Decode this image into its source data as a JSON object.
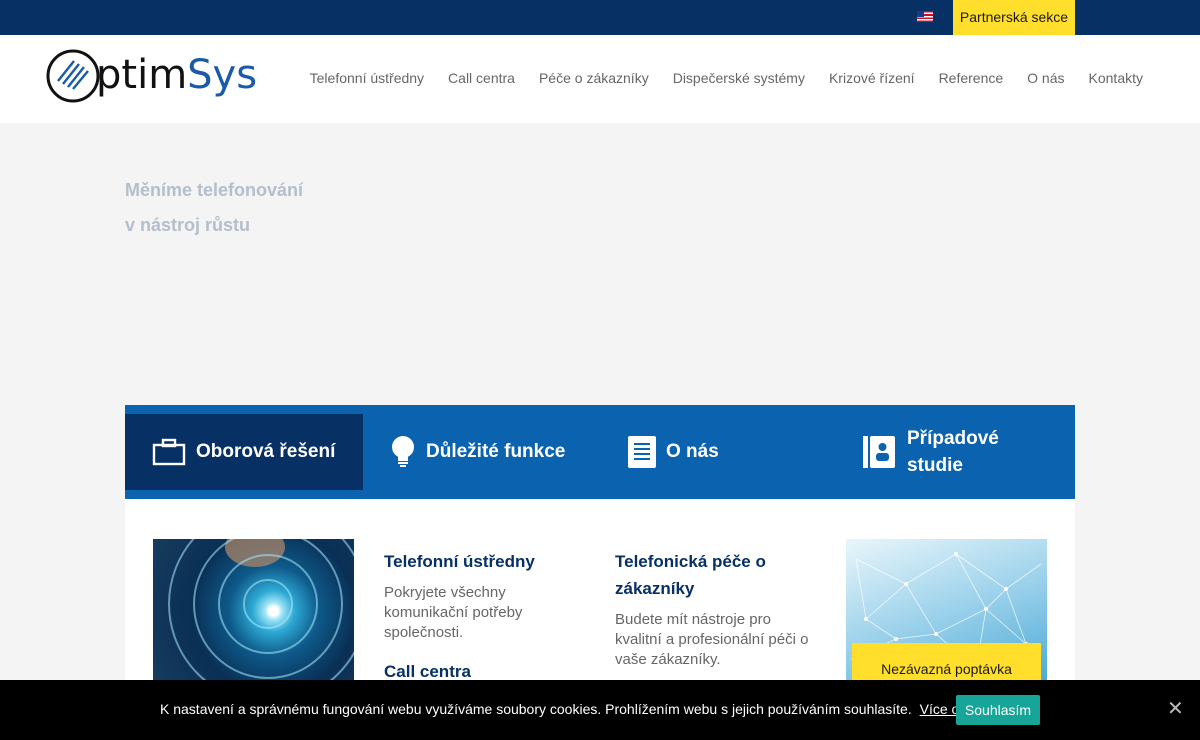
{
  "topbar": {
    "flag_icon": "us-flag-icon",
    "partner_label": "Partnerská sekce"
  },
  "logo": {
    "text_prefix": "ptim",
    "text_suffix": "Sys"
  },
  "nav": {
    "items": [
      "Telefonní ústředny",
      "Call centra",
      "Péče o zákazníky",
      "Dispečerské systémy",
      "Krizové řízení",
      "Reference",
      "O nás",
      "Kontakty"
    ]
  },
  "hero": {
    "line1": "Měníme telefonování",
    "line2": "v nástroj růstu"
  },
  "tabs": {
    "items": [
      {
        "label": "Oborová řešení",
        "icon": "briefcase-icon",
        "active": true
      },
      {
        "label": "Důležité funkce",
        "icon": "lightbulb-icon",
        "active": false
      },
      {
        "label": "O nás",
        "icon": "document-icon",
        "active": false
      },
      {
        "label_line1": "Případové",
        "label_line2": "studie",
        "icon": "contacts-book-icon",
        "active": false
      }
    ]
  },
  "content": {
    "col1": {
      "title": "Telefonní ústředny",
      "text": "Pokryjete všechny komunikační potřeby společnosti.",
      "title2": "Call centra"
    },
    "col2": {
      "title": "Telefonická péče o zákazníky",
      "text": "Budete mít nástroje pro kvalitní a profesionální péči o vaše zákazníky."
    },
    "cta_label": "Nezávazná poptávka"
  },
  "cookie": {
    "message": "K nastavení a správnému fungování webu využíváme soubory cookies. Prohlížením webu s jejich používáním souhlasíte.",
    "link": "Více o cookies",
    "accept": "Souhlasím",
    "close_icon": "close-icon"
  },
  "colors": {
    "topbar": "#073064",
    "accent_yellow": "#ffdf2b",
    "tab_blue": "#0b62ae",
    "cookie_button": "#16a596"
  }
}
